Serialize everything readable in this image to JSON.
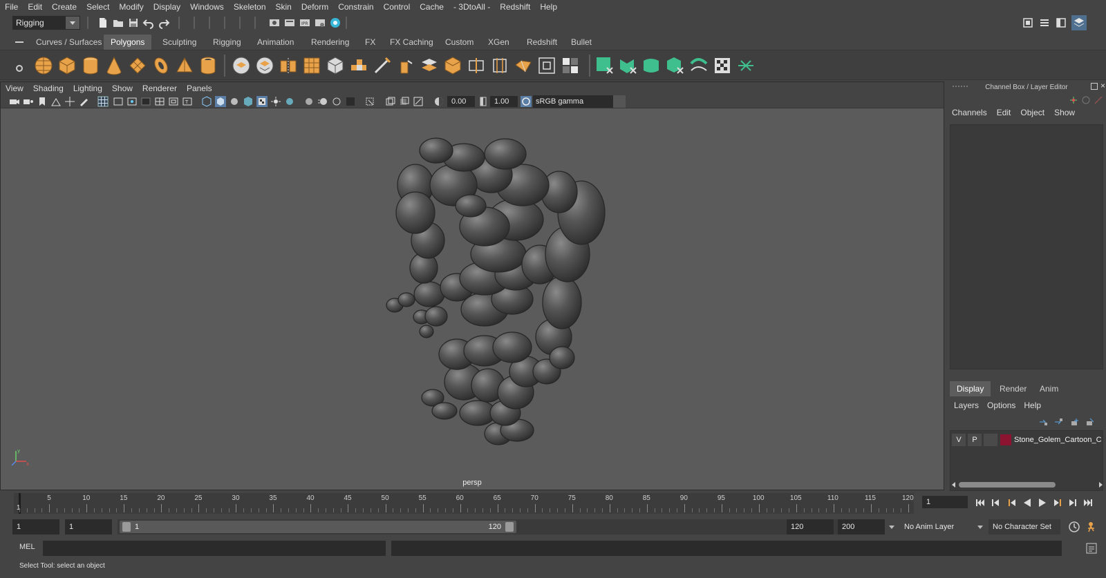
{
  "menubar": {
    "items": [
      "File",
      "Edit",
      "Create",
      "Select",
      "Modify",
      "Display",
      "Windows",
      "Skeleton",
      "Skin",
      "Deform",
      "Constrain",
      "Control",
      "Cache",
      "- 3DtoAll -",
      "Redshift",
      "Help"
    ]
  },
  "statusline": {
    "menuset": "Rigging"
  },
  "shelf": {
    "tabs": [
      "Curves / Surfaces",
      "Polygons",
      "Sculpting",
      "Rigging",
      "Animation",
      "Rendering",
      "FX",
      "FX Caching",
      "Custom",
      "XGen",
      "Redshift",
      "Bullet"
    ],
    "active_tab": "Polygons",
    "accent_color": "#e8a24a",
    "accent_green": "#3fbf8e"
  },
  "viewport": {
    "menus": [
      "View",
      "Shading",
      "Lighting",
      "Show",
      "Renderer",
      "Panels"
    ],
    "exposure": "0.00",
    "gamma": "1.00",
    "color_space": "sRGB gamma",
    "camera_label": "persp"
  },
  "channel_box": {
    "title": "Channel Box / Layer Editor",
    "menus": [
      "Channels",
      "Edit",
      "Object",
      "Show"
    ]
  },
  "layer_editor": {
    "tabs": [
      "Display",
      "Render",
      "Anim"
    ],
    "active_tab": "Display",
    "menus": [
      "Layers",
      "Options",
      "Help"
    ],
    "layers": [
      {
        "visible": "V",
        "playback": "P",
        "color": "#8c1430",
        "name": "Stone_Golem_Cartoon_C"
      }
    ]
  },
  "timeline": {
    "tick_labels": [
      "5",
      "10",
      "15",
      "20",
      "25",
      "30",
      "35",
      "40",
      "45",
      "50",
      "55",
      "60",
      "65",
      "70",
      "75",
      "80",
      "85",
      "90",
      "95",
      "100",
      "105",
      "110",
      "115",
      "120"
    ],
    "current_frame": "1",
    "current_frame_field": "1"
  },
  "range": {
    "start": "1",
    "playback_start": "1",
    "slider_start": "1",
    "slider_end": "120",
    "playback_end": "120",
    "end": "200",
    "anim_layer": "No Anim Layer",
    "character_set": "No Character Set"
  },
  "cmdline": {
    "label": "MEL"
  },
  "helpline": {
    "text": "Select Tool: select an object"
  }
}
